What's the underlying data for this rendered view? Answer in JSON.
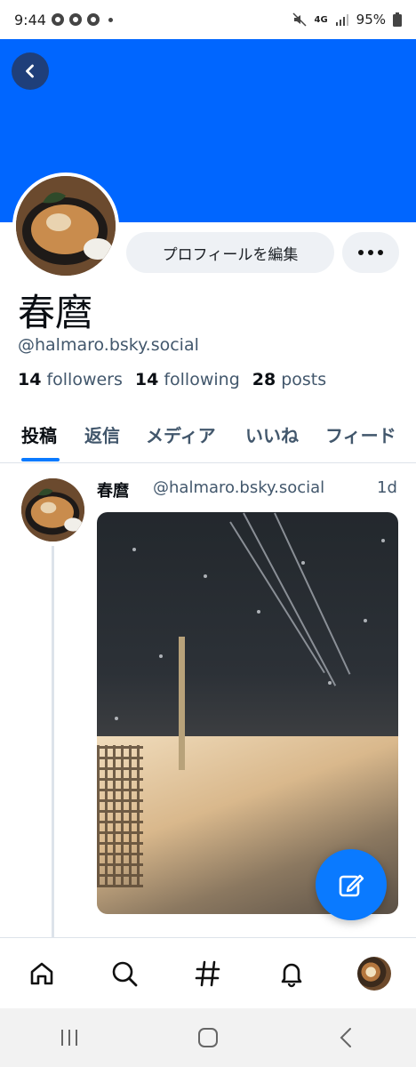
{
  "status_bar": {
    "time": "9:44",
    "battery": "95%",
    "network": "4G",
    "icons": [
      "chrome-icon",
      "chrome-icon",
      "chrome-icon",
      "mute-icon",
      "signal-icon",
      "battery-icon"
    ]
  },
  "header": {
    "banner_color": "#0066ff"
  },
  "profile": {
    "display_name": "春麿",
    "handle": "@halmaro.bsky.social",
    "edit_button_label": "プロフィールを編集",
    "followers_count": "14",
    "followers_label": "followers",
    "following_count": "14",
    "following_label": "following",
    "posts_count": "28",
    "posts_label": "posts"
  },
  "tabs": [
    {
      "label": "投稿",
      "active": true
    },
    {
      "label": "返信",
      "active": false
    },
    {
      "label": "メディア",
      "active": false
    },
    {
      "label": "いいね",
      "active": false
    },
    {
      "label": "フィード",
      "active": false
    }
  ],
  "post": {
    "author": "春麿",
    "handle": "@halmaro.bsky.social",
    "time": "1d"
  },
  "bottom_nav": [
    {
      "icon": "home-icon"
    },
    {
      "icon": "search-icon"
    },
    {
      "icon": "feeds-hash-icon"
    },
    {
      "icon": "notifications-bell-icon"
    },
    {
      "icon": "profile-avatar"
    }
  ],
  "colors": {
    "accent": "#0a7aff",
    "banner": "#0066ff",
    "muted_text": "#42576c"
  }
}
